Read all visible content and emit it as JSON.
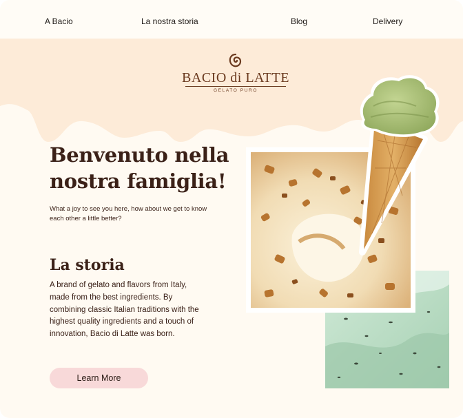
{
  "nav": {
    "items": [
      {
        "label": "A Bacio"
      },
      {
        "label": "La nostra storia"
      },
      {
        "label": "Blog"
      },
      {
        "label": "Delivery"
      }
    ]
  },
  "brand": {
    "name": "BACIO di LATTE",
    "tagline": "GELATO PURO",
    "color": "#6b3a1f"
  },
  "hero": {
    "title": "Benvenuto nella nostra famiglia!",
    "subtitle": "What a joy to see you here, how about we get to know each other a little better?"
  },
  "story": {
    "title": "La storia",
    "body": "A brand of gelato and flavors from Italy, made from the best ingredients. By combining classic Italian traditions with the highest quality ingredients and a touch of innovation, Bacio di Latte was born.",
    "button_label": "Learn More"
  },
  "colors": {
    "background": "#fffaf2",
    "peach_band": "#fdebd8",
    "text": "#3b2118",
    "button": "#f8d9d9",
    "pistachio": "#a9c17a",
    "mint": "#b6dcc2"
  }
}
